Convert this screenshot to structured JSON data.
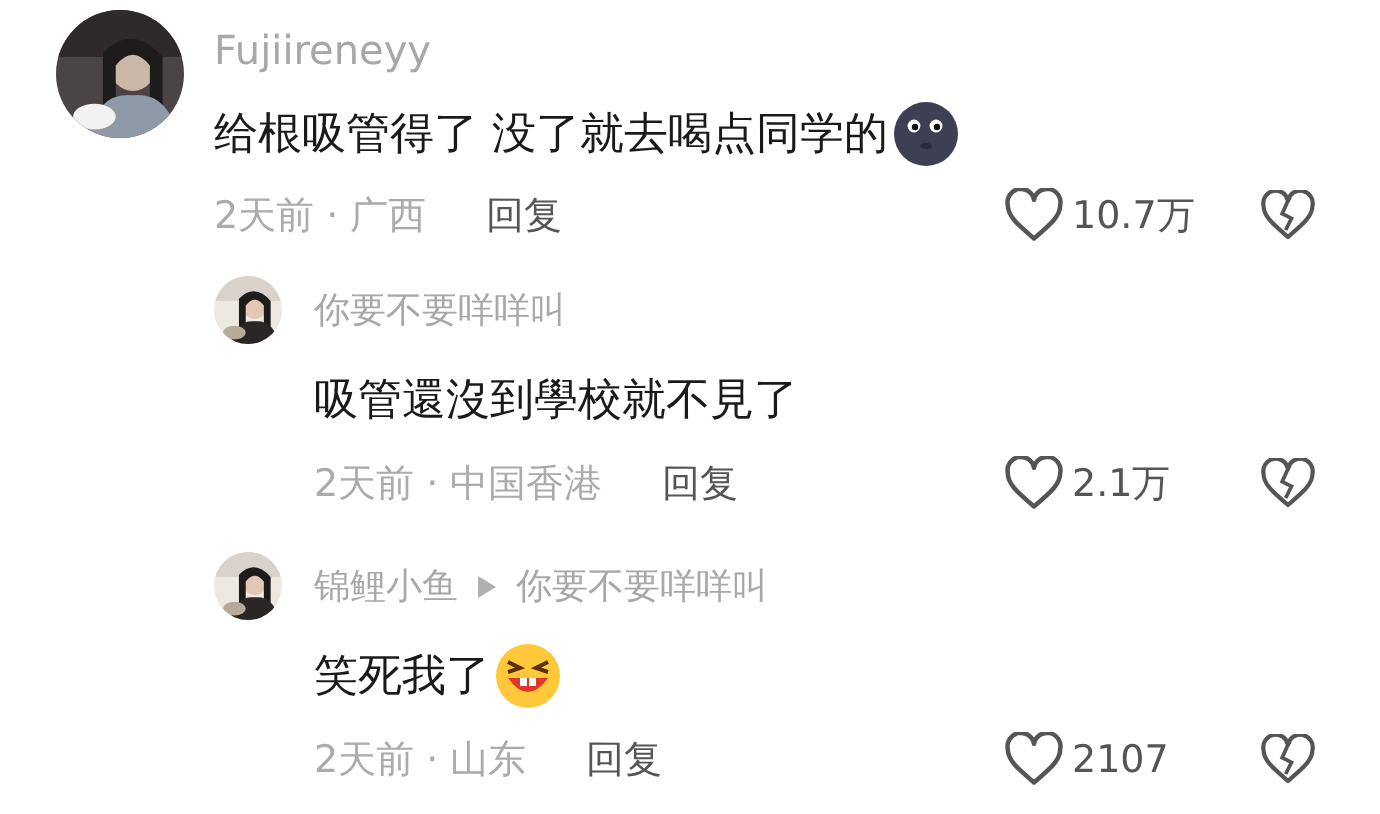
{
  "comments": [
    {
      "author": "Fujiireneyy",
      "text": "给根吸管得了 没了就去喝点同学的",
      "emoji": {
        "kind": "moon"
      },
      "meta": "2天前 · 广西",
      "reply_label": "回复",
      "likes": "10.7万",
      "replies": [
        {
          "author": "你要不要咩咩叫",
          "text": "吸管還沒到學校就不見了",
          "meta": "2天前 · 中国香港",
          "reply_label": "回复",
          "likes": "2.1万"
        },
        {
          "author": "锦鲤小鱼",
          "reply_to": "你要不要咩咩叫",
          "text": "笑死我了",
          "emoji": {
            "kind": "laughing"
          },
          "meta": "2天前 · 山东",
          "reply_label": "回复",
          "likes": "2107"
        }
      ]
    }
  ]
}
